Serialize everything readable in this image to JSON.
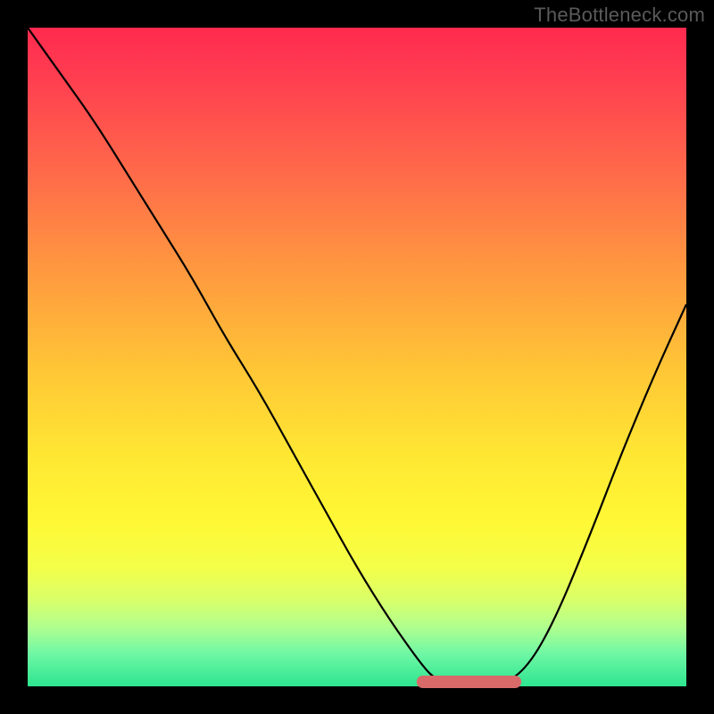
{
  "watermark": "TheBottleneck.com",
  "chart_data": {
    "type": "line",
    "title": "",
    "xlabel": "",
    "ylabel": "",
    "xlim": [
      0,
      100
    ],
    "ylim": [
      0,
      100
    ],
    "background_gradient": {
      "top": "#ff2a4f",
      "mid": "#ffe733",
      "bottom": "#2de58f"
    },
    "series": [
      {
        "name": "bottleneck-curve",
        "x": [
          0,
          5,
          10,
          15,
          20,
          25,
          30,
          35,
          40,
          45,
          50,
          55,
          60,
          62,
          65,
          68,
          72,
          76,
          80,
          85,
          90,
          95,
          100
        ],
        "values": [
          100,
          93,
          86,
          78,
          70,
          62,
          53,
          45,
          36,
          27,
          18,
          10,
          3,
          1,
          0,
          0,
          0,
          3,
          10,
          22,
          35,
          47,
          58
        ]
      }
    ],
    "highlight_valley": {
      "x_start": 60,
      "x_end": 74,
      "y": 0,
      "color": "#d86a6a"
    },
    "grid": false,
    "legend": false
  }
}
